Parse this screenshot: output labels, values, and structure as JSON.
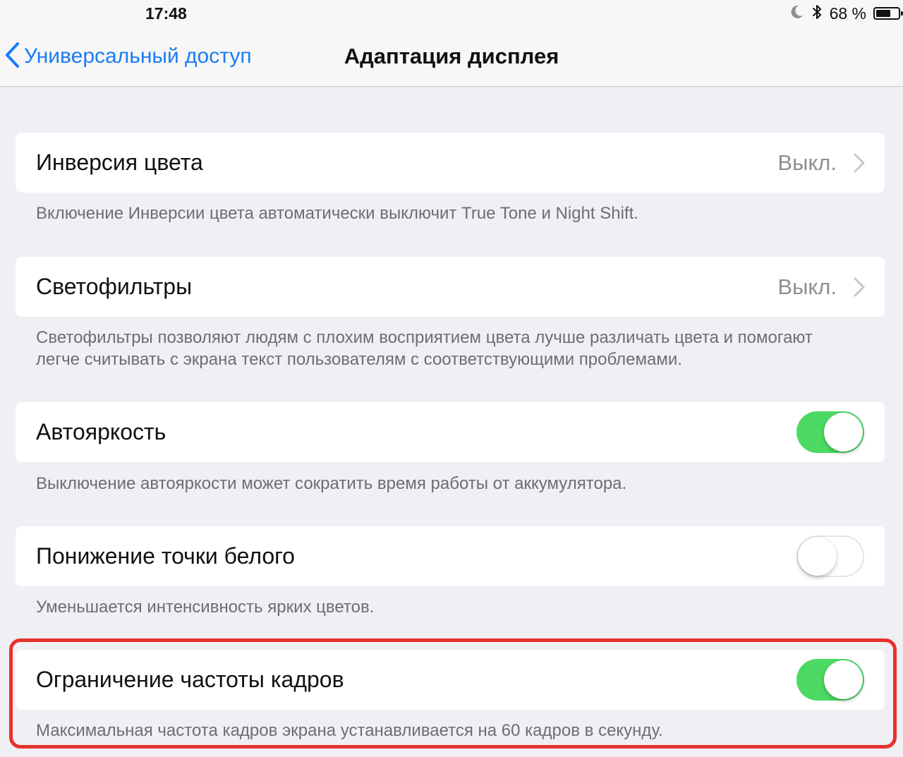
{
  "status_bar": {
    "time": "17:48",
    "battery_text": "68 %",
    "battery_level": 0.68,
    "icons": [
      "moon-icon",
      "bluetooth-icon",
      "battery-icon"
    ]
  },
  "nav": {
    "back_label": "Универсальный доступ",
    "title": "Адаптация дисплея",
    "accent_color": "#1a7cf7"
  },
  "settings": [
    {
      "label": "Инверсия цвета",
      "value": "Выкл.",
      "footer": "Включение Инверсии цвета автоматически выключит True Tone и Night Shift."
    },
    {
      "label": "Светофильтры",
      "value": "Выкл.",
      "footer_lines": [
        "Светофильтры позволяют людям с плохим восприятием цвета лучше различать цвета и помогают",
        "легче считывать с экрана текст пользователям с соответствующими проблемами."
      ]
    },
    {
      "label": "Автояркость",
      "toggle": true,
      "footer": "Выключение автояркости может сократить время работы от аккумулятора."
    },
    {
      "label": "Понижение точки белого",
      "toggle": false,
      "footer": "Уменьшается интенсивность ярких цветов."
    },
    {
      "label": "Ограничение частоты кадров",
      "toggle": true,
      "footer": "Максимальная частота кадров экрана устанавливается на 60 кадров в секунду.",
      "highlighted": true
    }
  ],
  "colors": {
    "background": "#efeff4",
    "toggle_on": "#4cd964",
    "highlight": "#e8312c"
  }
}
